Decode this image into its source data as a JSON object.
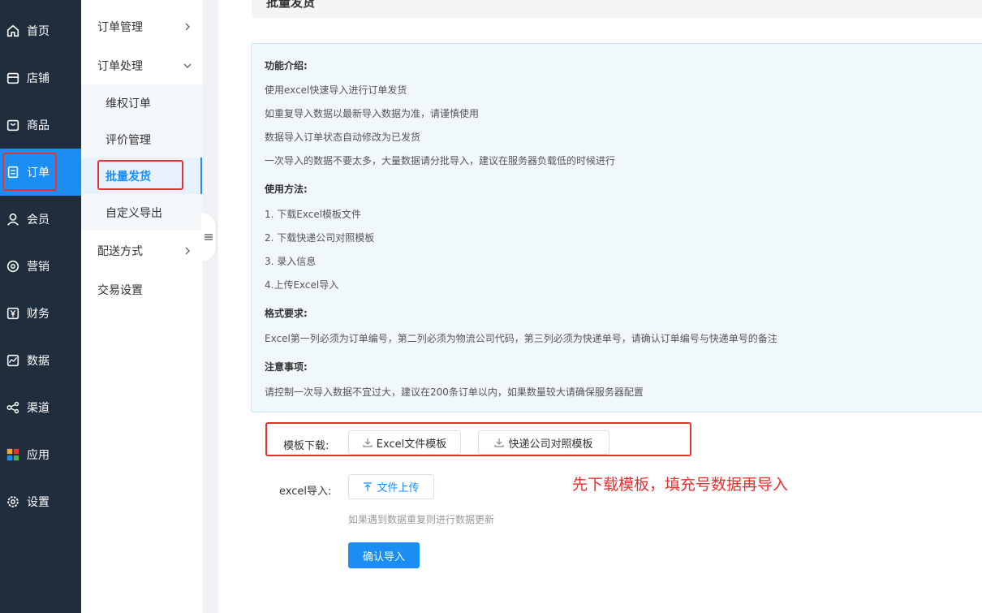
{
  "nav": {
    "items": [
      {
        "label": "首页",
        "icon": "home-icon"
      },
      {
        "label": "店铺",
        "icon": "store-icon"
      },
      {
        "label": "商品",
        "icon": "bag-icon"
      },
      {
        "label": "订单",
        "icon": "order-icon"
      },
      {
        "label": "会员",
        "icon": "user-icon"
      },
      {
        "label": "营销",
        "icon": "marketing-icon"
      },
      {
        "label": "财务",
        "icon": "yen-icon"
      },
      {
        "label": "数据",
        "icon": "chart-icon"
      },
      {
        "label": "渠道",
        "icon": "channel-icon"
      },
      {
        "label": "应用",
        "icon": "apps-icon"
      },
      {
        "label": "设置",
        "icon": "settings-icon"
      }
    ]
  },
  "subnav": {
    "order_manage": "订单管理",
    "order_process": "订单处理",
    "items": [
      "维权订单",
      "评价管理",
      "批量发货",
      "自定义导出"
    ],
    "delivery": "配送方式",
    "trade_settings": "交易设置"
  },
  "page": {
    "title": "批量发货"
  },
  "info": {
    "intro_title": "功能介绍:",
    "intro": [
      "使用excel快速导入进行订单发货",
      "如重复导入数据以最新导入数据为准，请谨慎使用",
      "数据导入订单状态自动修改为已发货",
      "一次导入的数据不要太多，大量数据请分批导入，建议在服务器负载低的时候进行"
    ],
    "usage_title": "使用方法:",
    "usage": [
      "1. 下载Excel模板文件",
      "2. 下载快递公司对照模板",
      "3. 录入信息",
      "4.上传Excel导入"
    ],
    "format_title": "格式要求:",
    "format": "Excel第一列必须为订单编号，第二列必须为物流公司代码，第三列必须为快递单号，请确认订单编号与快递单号的备注",
    "notice_title": "注意事项:",
    "notice": "请控制一次导入数据不宜过大，建议在200条订单以内，如果数量较大请确保服务器配置"
  },
  "form": {
    "template_label": "模板下载:",
    "excel_template": "Excel文件模板",
    "express_template": "快递公司对照模板",
    "import_label": "excel导入:",
    "upload": "文件上传",
    "hint": "如果遇到数据重复则进行数据更新",
    "confirm": "确认导入"
  },
  "annotation": "先下载模板，填充号数据再导入",
  "colors": {
    "accent": "#1a8ef5",
    "nav_bg": "#1f2d3d",
    "highlight": "#e8302f"
  }
}
